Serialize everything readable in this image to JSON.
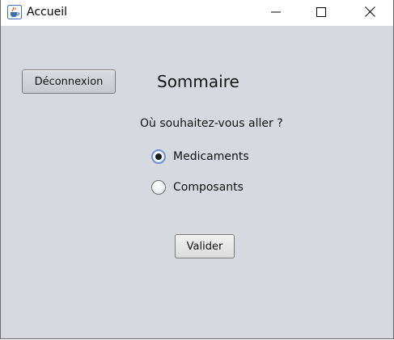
{
  "window": {
    "title": "Accueil",
    "icon": "java-cup-icon"
  },
  "controls": {
    "minimize": "minimize-icon",
    "maximize": "maximize-icon",
    "close": "close-icon"
  },
  "main": {
    "logout_label": "Déconnexion",
    "heading": "Sommaire",
    "question": "Où souhaitez-vous aller ?",
    "options": [
      {
        "label": "Medicaments",
        "selected": true
      },
      {
        "label": "Composants",
        "selected": false
      }
    ],
    "validate_label": "Valider"
  },
  "colors": {
    "background": "#d6d9e0",
    "radio_focus": "#6b8fd6"
  }
}
